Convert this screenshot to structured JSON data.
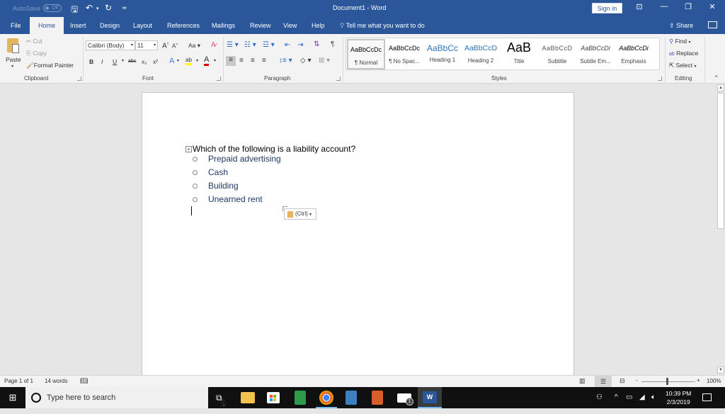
{
  "titlebar": {
    "autosave_label": "AutoSave",
    "autosave_state": "Off",
    "doc_title": "Document1  -  Word",
    "sign_in": "Sign in",
    "qat_save": "save-icon",
    "qat_undo": "undo-icon",
    "qat_redo": "redo-icon",
    "qat_customize": "customize-icon"
  },
  "tabs": [
    {
      "label": "File"
    },
    {
      "label": "Home",
      "active": true
    },
    {
      "label": "Insert"
    },
    {
      "label": "Design"
    },
    {
      "label": "Layout"
    },
    {
      "label": "References"
    },
    {
      "label": "Mailings"
    },
    {
      "label": "Review"
    },
    {
      "label": "View"
    },
    {
      "label": "Help"
    }
  ],
  "tellme": "Tell me what you want to do",
  "share": "Share",
  "ribbon": {
    "clipboard": {
      "label": "Clipboard",
      "paste": "Paste",
      "cut": "Cut",
      "copy": "Copy",
      "format_painter": "Format Painter"
    },
    "font": {
      "label": "Font",
      "family": "Calibri (Body)",
      "size": "11",
      "change_case": "Aa",
      "bold": "B",
      "italic": "I",
      "underline": "U",
      "strikethrough": "abc",
      "subscript": "x₂",
      "superscript": "x²"
    },
    "paragraph": {
      "label": "Paragraph"
    },
    "styles": {
      "label": "Styles",
      "items": [
        {
          "preview": "AaBbCcDc",
          "name": "¶ Normal",
          "selected": true
        },
        {
          "preview": "AaBbCcDc",
          "name": "¶ No Spac..."
        },
        {
          "preview": "AaBbCc",
          "name": "Heading 1"
        },
        {
          "preview": "AaBbCcD",
          "name": "Heading 2"
        },
        {
          "preview": "AaB",
          "name": "Title"
        },
        {
          "preview": "AaBbCcD",
          "name": "Subtitle"
        },
        {
          "preview": "AaBbCcDi",
          "name": "Subtle Em..."
        },
        {
          "preview": "AaBbCcDi",
          "name": "Emphasis"
        }
      ]
    },
    "editing": {
      "label": "Editing",
      "find": "Find",
      "replace": "Replace",
      "select": "Select"
    }
  },
  "document": {
    "question": "Which of the following is a liability account?",
    "options": [
      "Prepaid advertising",
      "Cash",
      "Building",
      "Unearned rent"
    ],
    "paste_options": "(Ctrl)"
  },
  "statusbar": {
    "page": "Page 1 of 1",
    "words": "14 words",
    "zoom": "100%",
    "zoom_minus": "-",
    "zoom_plus": "+"
  },
  "taskbar": {
    "search_placeholder": "Type here to search",
    "time": "10:39 PM",
    "date": "2/3/2019",
    "mail_badge": "1"
  },
  "colors": {
    "word_blue": "#2b579a",
    "option_text": "#1f3864",
    "taskbar": "#101010"
  }
}
